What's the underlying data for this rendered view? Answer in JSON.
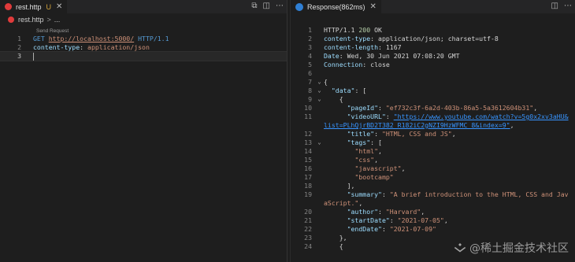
{
  "left": {
    "tab": {
      "label": "rest.http",
      "modified": "U",
      "close": "✕"
    },
    "actions": [
      "⧉",
      "◫",
      "⋯"
    ],
    "breadcrumb": {
      "file": "rest.http",
      "sep": ">",
      "more": "..."
    },
    "codelens": "Send Request",
    "lines": [
      {
        "n": "1",
        "parts": [
          {
            "t": "GET ",
            "c": "kw"
          },
          {
            "t": "http://localhost:5000/",
            "c": "url"
          },
          {
            "t": " ",
            "c": ""
          },
          {
            "t": "HTTP",
            "c": "kw"
          },
          {
            "t": "/1.1",
            "c": "kw"
          }
        ]
      },
      {
        "n": "2",
        "parts": [
          {
            "t": "content-type",
            "c": "hdr"
          },
          {
            "t": ": ",
            "c": "punc"
          },
          {
            "t": "application/json",
            "c": "str"
          }
        ]
      },
      {
        "n": "3",
        "parts": [],
        "cursor": true
      }
    ]
  },
  "right": {
    "tab": {
      "label": "Response(862ms)",
      "close": "✕"
    },
    "actions": [
      "◫",
      "⋯"
    ],
    "lines": [
      {
        "n": "1",
        "parts": [
          {
            "t": "HTTP/1.1 ",
            "c": ""
          },
          {
            "t": "200",
            "c": "num"
          },
          {
            "t": " OK",
            "c": ""
          }
        ]
      },
      {
        "n": "2",
        "parts": [
          {
            "t": "content-type",
            "c": "hdr"
          },
          {
            "t": ": application/json; charset=utf-8",
            "c": ""
          }
        ]
      },
      {
        "n": "3",
        "parts": [
          {
            "t": "content-length",
            "c": "hdr"
          },
          {
            "t": ": 1167",
            "c": ""
          }
        ]
      },
      {
        "n": "4",
        "parts": [
          {
            "t": "Date",
            "c": "hdr"
          },
          {
            "t": ": Wed, 30 Jun 2021 07:08:20 GMT",
            "c": ""
          }
        ]
      },
      {
        "n": "5",
        "parts": [
          {
            "t": "Connection",
            "c": "hdr"
          },
          {
            "t": ": close",
            "c": ""
          }
        ]
      },
      {
        "n": "6",
        "parts": []
      },
      {
        "n": "7",
        "fold": "⌄",
        "parts": [
          {
            "t": "{",
            "c": "punc"
          }
        ]
      },
      {
        "n": "8",
        "fold": "⌄",
        "parts": [
          {
            "t": "  ",
            "c": ""
          },
          {
            "t": "\"data\"",
            "c": "key"
          },
          {
            "t": ": [",
            "c": "punc"
          }
        ]
      },
      {
        "n": "9",
        "fold": "⌄",
        "parts": [
          {
            "t": "    {",
            "c": "punc"
          }
        ]
      },
      {
        "n": "10",
        "parts": [
          {
            "t": "      ",
            "c": ""
          },
          {
            "t": "\"pageId\"",
            "c": "key"
          },
          {
            "t": ": ",
            "c": "punc"
          },
          {
            "t": "\"ef732c3f-6a2d-403b-86a5-5a3612604b31\"",
            "c": "str"
          },
          {
            "t": ",",
            "c": "punc"
          }
        ]
      },
      {
        "n": "11",
        "parts": [
          {
            "t": "      ",
            "c": ""
          },
          {
            "t": "\"videoURL\"",
            "c": "key"
          },
          {
            "t": ": ",
            "c": "punc"
          },
          {
            "t": "\"https://www.youtube.com/watch?v=5g0x2xv3aHU&",
            "c": "link"
          }
        ]
      },
      {
        "n": "",
        "parts": [
          {
            "t": "list=PLhQjrBD2T382_R182iC2gNZI9HzWFMC_8&index=9\"",
            "c": "link"
          },
          {
            "t": ",",
            "c": "punc"
          }
        ]
      },
      {
        "n": "12",
        "parts": [
          {
            "t": "      ",
            "c": ""
          },
          {
            "t": "\"title\"",
            "c": "key"
          },
          {
            "t": ": ",
            "c": "punc"
          },
          {
            "t": "\"HTML, CSS and JS\"",
            "c": "str"
          },
          {
            "t": ",",
            "c": "punc"
          }
        ]
      },
      {
        "n": "13",
        "fold": "⌄",
        "parts": [
          {
            "t": "      ",
            "c": ""
          },
          {
            "t": "\"tags\"",
            "c": "key"
          },
          {
            "t": ": [",
            "c": "punc"
          }
        ]
      },
      {
        "n": "14",
        "parts": [
          {
            "t": "        ",
            "c": ""
          },
          {
            "t": "\"html\"",
            "c": "str"
          },
          {
            "t": ",",
            "c": "punc"
          }
        ]
      },
      {
        "n": "15",
        "parts": [
          {
            "t": "        ",
            "c": ""
          },
          {
            "t": "\"css\"",
            "c": "str"
          },
          {
            "t": ",",
            "c": "punc"
          }
        ]
      },
      {
        "n": "16",
        "parts": [
          {
            "t": "        ",
            "c": ""
          },
          {
            "t": "\"javascript\"",
            "c": "str"
          },
          {
            "t": ",",
            "c": "punc"
          }
        ]
      },
      {
        "n": "17",
        "parts": [
          {
            "t": "        ",
            "c": ""
          },
          {
            "t": "\"bootcamp\"",
            "c": "str"
          }
        ]
      },
      {
        "n": "18",
        "parts": [
          {
            "t": "      ],",
            "c": "punc"
          }
        ]
      },
      {
        "n": "19",
        "parts": [
          {
            "t": "      ",
            "c": ""
          },
          {
            "t": "\"summary\"",
            "c": "key"
          },
          {
            "t": ": ",
            "c": "punc"
          },
          {
            "t": "\"A brief introduction to the HTML, CSS and Jav",
            "c": "str"
          }
        ]
      },
      {
        "n": "",
        "parts": [
          {
            "t": "aScript.\"",
            "c": "str"
          },
          {
            "t": ",",
            "c": "punc"
          }
        ]
      },
      {
        "n": "20",
        "parts": [
          {
            "t": "      ",
            "c": ""
          },
          {
            "t": "\"author\"",
            "c": "key"
          },
          {
            "t": ": ",
            "c": "punc"
          },
          {
            "t": "\"Harvard\"",
            "c": "str"
          },
          {
            "t": ",",
            "c": "punc"
          }
        ]
      },
      {
        "n": "21",
        "parts": [
          {
            "t": "      ",
            "c": ""
          },
          {
            "t": "\"startDate\"",
            "c": "key"
          },
          {
            "t": ": ",
            "c": "punc"
          },
          {
            "t": "\"2021-07-05\"",
            "c": "str"
          },
          {
            "t": ",",
            "c": "punc"
          }
        ]
      },
      {
        "n": "22",
        "parts": [
          {
            "t": "      ",
            "c": ""
          },
          {
            "t": "\"endDate\"",
            "c": "key"
          },
          {
            "t": ": ",
            "c": "punc"
          },
          {
            "t": "\"2021-07-09\"",
            "c": "str"
          }
        ]
      },
      {
        "n": "23",
        "parts": [
          {
            "t": "    },",
            "c": "punc"
          }
        ]
      },
      {
        "n": "24",
        "parts": [
          {
            "t": "    {",
            "c": "punc"
          }
        ]
      }
    ]
  },
  "watermark": "@稀土掘金技术社区",
  "colors": {
    "background": "#1e1e1e",
    "tab_dot_red": "#e03b3b",
    "tab_dot_blue": "#2f7fd4",
    "modified": "#d7a63b"
  }
}
